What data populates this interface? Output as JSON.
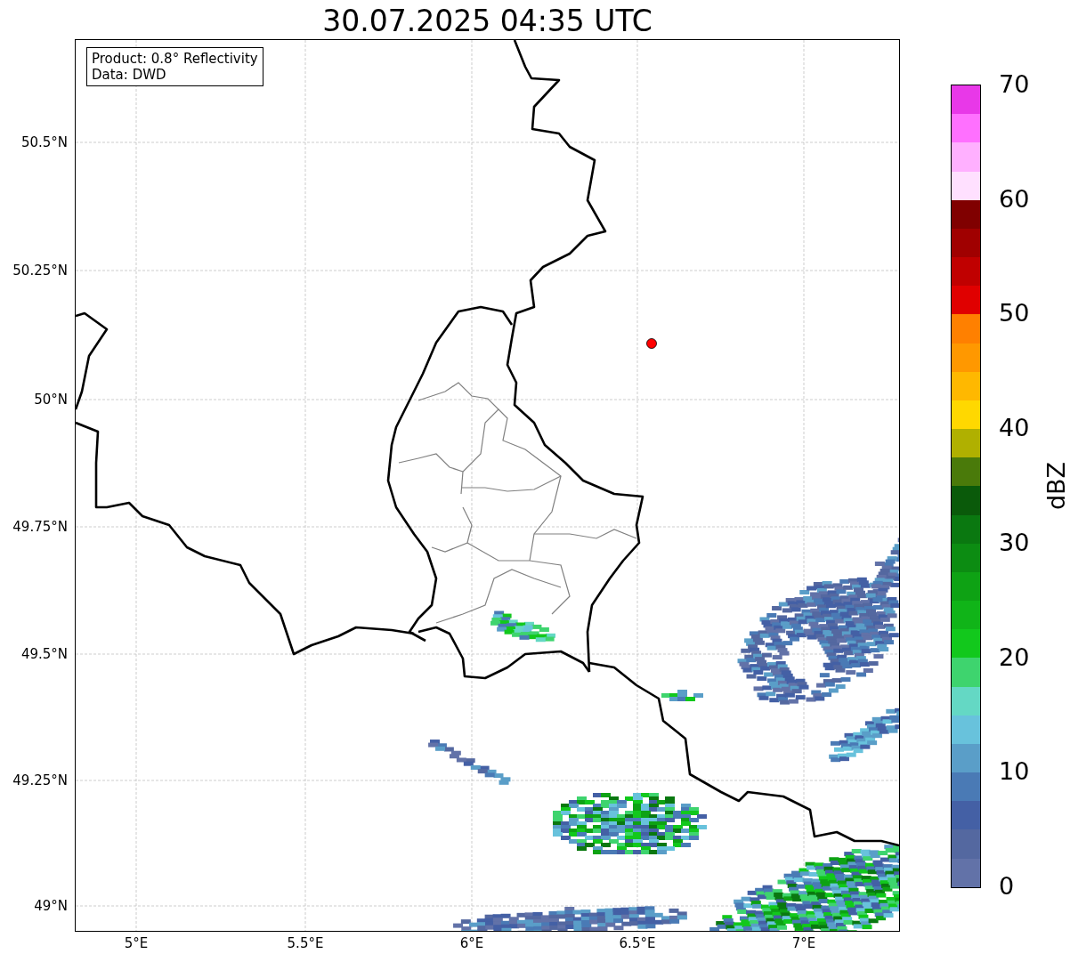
{
  "title": "30.07.2025 04:35 UTC",
  "legend": {
    "lines": [
      "Product: 0.8° Reflectivity",
      "Data: DWD"
    ]
  },
  "map": {
    "lat_ticks": [
      "50.5°N",
      "50.25°N",
      "50°N",
      "49.75°N",
      "49.5°N",
      "49.25°N",
      "49°N"
    ],
    "lon_ticks": [
      "5°E",
      "5.5°E",
      "6°E",
      "6.5°E",
      "7°E"
    ]
  },
  "colorbar": {
    "label": "dBZ",
    "ticks": [
      "70",
      "60",
      "50",
      "40",
      "30",
      "20",
      "10",
      "0"
    ],
    "bands": [
      {
        "color": "#6272a8"
      },
      {
        "color": "#5468a0"
      },
      {
        "color": "#4460a5"
      },
      {
        "color": "#4a7ab5"
      },
      {
        "color": "#5a9ec8"
      },
      {
        "color": "#68c2dc"
      },
      {
        "color": "#64d8c4"
      },
      {
        "color": "#3ed46e"
      },
      {
        "color": "#12c81c"
      },
      {
        "color": "#10b418"
      },
      {
        "color": "#0ea214"
      },
      {
        "color": "#0c8c12"
      },
      {
        "color": "#0a7810"
      },
      {
        "color": "#0a5a0a"
      },
      {
        "color": "#4a7a0a"
      },
      {
        "color": "#b0b000"
      },
      {
        "color": "#ffd800"
      },
      {
        "color": "#ffb800"
      },
      {
        "color": "#ff9800"
      },
      {
        "color": "#ff8000"
      },
      {
        "color": "#e00000"
      },
      {
        "color": "#c00000"
      },
      {
        "color": "#a00000"
      },
      {
        "color": "#800000"
      },
      {
        "color": "#ffe0ff"
      },
      {
        "color": "#ffb0ff"
      },
      {
        "color": "#ff70ff"
      },
      {
        "color": "#e838e8"
      }
    ]
  }
}
